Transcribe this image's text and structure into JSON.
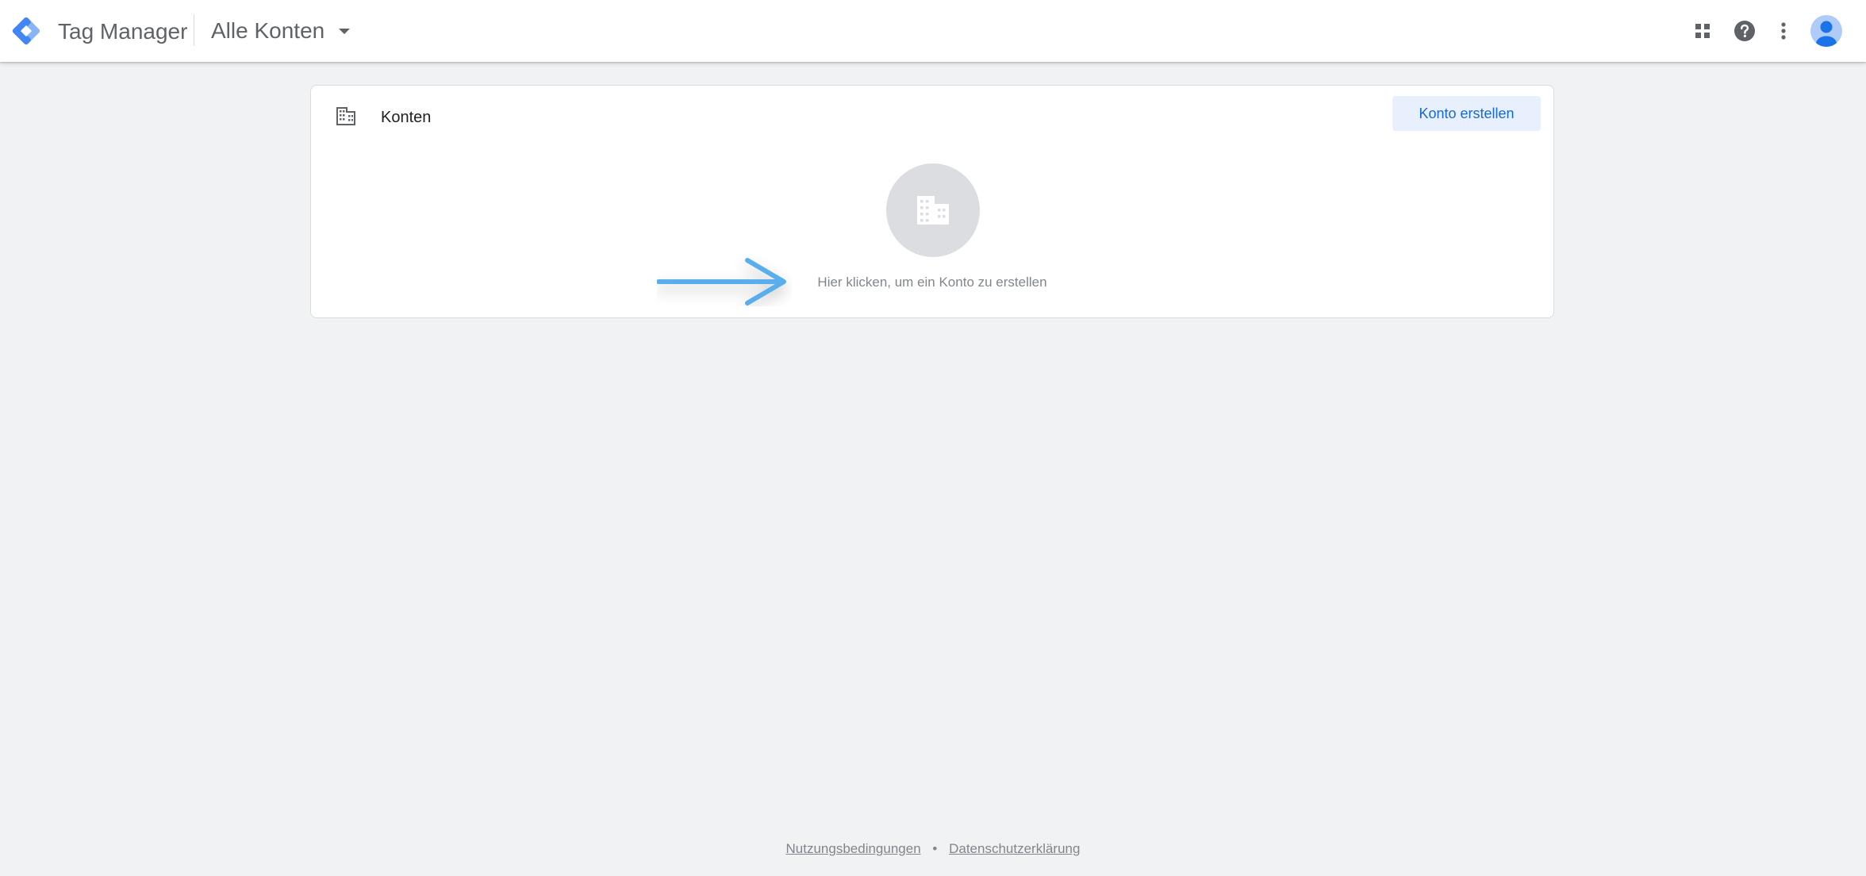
{
  "header": {
    "product_name": "Tag Manager",
    "account_picker_label": "Alle Konten",
    "icons": [
      "apps-grid-icon",
      "help-icon",
      "more-vert-icon",
      "account-avatar-icon"
    ]
  },
  "accounts_card": {
    "title": "Konten",
    "create_button_label": "Konto erstellen",
    "empty_state_text": "Hier klicken, um ein Konto zu erstellen",
    "icon": "building-icon"
  },
  "footer": {
    "terms_link": "Nutzungsbedingungen",
    "separator": "•",
    "privacy_link": "Datenschutzerklärung"
  },
  "colors": {
    "page_background": "#f1f2f4",
    "primary_button_bg": "#e8f0fe",
    "primary_button_text": "#1967d2",
    "annotation_arrow": "#5aaeec",
    "logo_blue": "#4285f4",
    "logo_light_blue": "#8ab4f8"
  }
}
